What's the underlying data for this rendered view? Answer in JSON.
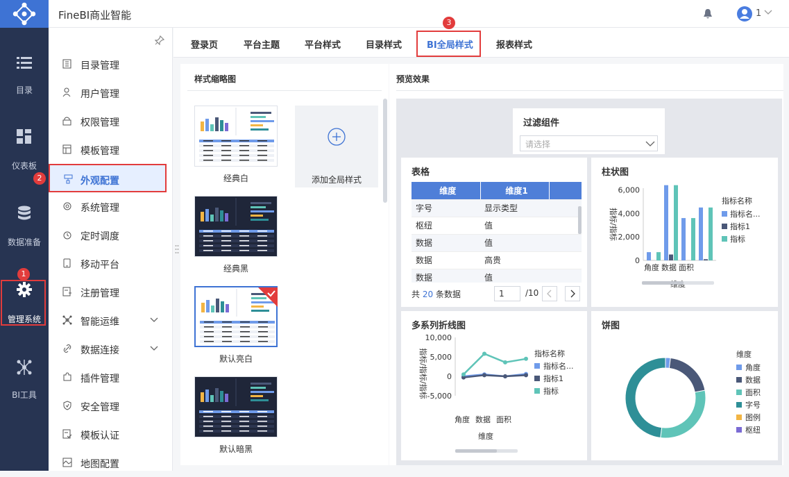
{
  "app": {
    "title": "FineBI商业智能",
    "user": "1"
  },
  "rail": [
    {
      "label": "目录",
      "icon": "list-icon"
    },
    {
      "label": "仪表板",
      "icon": "dashboard-icon"
    },
    {
      "label": "数据准备",
      "icon": "database-icon"
    },
    {
      "label": "管理系统",
      "icon": "gear-icon",
      "active": true
    },
    {
      "label": "BI工具",
      "icon": "network-icon"
    }
  ],
  "sidebar": [
    {
      "label": "目录管理",
      "icon": "catalog-icon"
    },
    {
      "label": "用户管理",
      "icon": "user-icon"
    },
    {
      "label": "权限管理",
      "icon": "lock-icon"
    },
    {
      "label": "模板管理",
      "icon": "template-icon"
    },
    {
      "label": "外观配置",
      "icon": "brush-icon",
      "active": true
    },
    {
      "label": "系统管理",
      "icon": "gear-icon"
    },
    {
      "label": "定时调度",
      "icon": "clock-icon"
    },
    {
      "label": "移动平台",
      "icon": "mobile-icon"
    },
    {
      "label": "注册管理",
      "icon": "register-icon"
    },
    {
      "label": "智能运维",
      "icon": "ops-icon",
      "expand": true
    },
    {
      "label": "数据连接",
      "icon": "link-icon",
      "expand": true
    },
    {
      "label": "插件管理",
      "icon": "plugin-icon"
    },
    {
      "label": "安全管理",
      "icon": "shield-icon"
    },
    {
      "label": "模板认证",
      "icon": "cert-icon"
    },
    {
      "label": "地图配置",
      "icon": "map-icon"
    }
  ],
  "badges": {
    "one": "1",
    "two": "2",
    "three": "3"
  },
  "tabs": [
    "登录页",
    "平台主题",
    "平台样式",
    "目录样式",
    "BI全局样式",
    "报表样式"
  ],
  "left": {
    "title": "样式缩略图",
    "thumbs": [
      {
        "label": "经典白",
        "theme": "light"
      },
      {
        "label": "经典黑",
        "theme": "dark"
      },
      {
        "label": "默认亮白",
        "theme": "light",
        "selected": true
      },
      {
        "label": "默认暗黑",
        "theme": "dark"
      }
    ],
    "add_label": "添加全局样式"
  },
  "preview": {
    "title": "预览效果",
    "filter": {
      "title": "过滤组件",
      "placeholder": "请选择"
    },
    "table": {
      "title": "表格",
      "headers": [
        "维度",
        "维度1"
      ],
      "rows": [
        [
          "字号",
          "显示类型"
        ],
        [
          "枢纽",
          "值"
        ],
        [
          "数据",
          "值"
        ],
        [
          "数据",
          "高贵"
        ],
        [
          "数据",
          "值"
        ]
      ],
      "footer_prefix": "共",
      "footer_count": "20",
      "footer_suffix": "条数据",
      "page": "1",
      "total_pages": "/10"
    }
  },
  "colors": {
    "accent": "#3e73d4",
    "rail": "#273452",
    "c1": "#6f9bea",
    "c2": "#4a5878",
    "c3": "#5fc4b8",
    "c4": "#2e8f97",
    "c5": "#f2b544",
    "c6": "#7b6bd4"
  },
  "chart_data": [
    {
      "type": "bar",
      "title": "柱状图",
      "categories": [
        "角度",
        "数据",
        "面积"
      ],
      "series": [
        {
          "name": "指标名...",
          "values": [
            700,
            6400,
            3600,
            4500
          ]
        },
        {
          "name": "指标1",
          "values": [
            0,
            500,
            0,
            100
          ]
        },
        {
          "name": "指标",
          "values": [
            700,
            6400,
            3600,
            4500
          ]
        }
      ],
      "xlabel": "维度",
      "ylabel": "指标/指标",
      "yticks": [
        "6,000",
        "4,000",
        "2,000",
        "0"
      ],
      "ylim": [
        0,
        6500
      ],
      "legend_title": "指标名称"
    },
    {
      "type": "line",
      "title": "多系列折线图",
      "categories": [
        "角度",
        "数据",
        "面积"
      ],
      "series": [
        {
          "name": "指标名...",
          "values": [
            0,
            500,
            0,
            600
          ]
        },
        {
          "name": "指标1",
          "values": [
            -300,
            300,
            0,
            300
          ]
        },
        {
          "name": "指标",
          "values": [
            500,
            5800,
            3600,
            4500
          ]
        }
      ],
      "xlabel": "维度",
      "ylabel": "指标/指标/指标",
      "yticks": [
        "10,000",
        "5,000",
        "0",
        "-5,000"
      ],
      "ylim": [
        -5000,
        10000
      ],
      "legend_title": "指标名称"
    },
    {
      "type": "pie",
      "title": "饼图",
      "legend_title": "维度",
      "slices": [
        {
          "name": "角度",
          "value": 2
        },
        {
          "name": "数据",
          "value": 20
        },
        {
          "name": "面积",
          "value": 30
        },
        {
          "name": "字号",
          "value": 48
        },
        {
          "name": "图例",
          "value": 0
        },
        {
          "name": "枢纽",
          "value": 0
        }
      ]
    }
  ]
}
